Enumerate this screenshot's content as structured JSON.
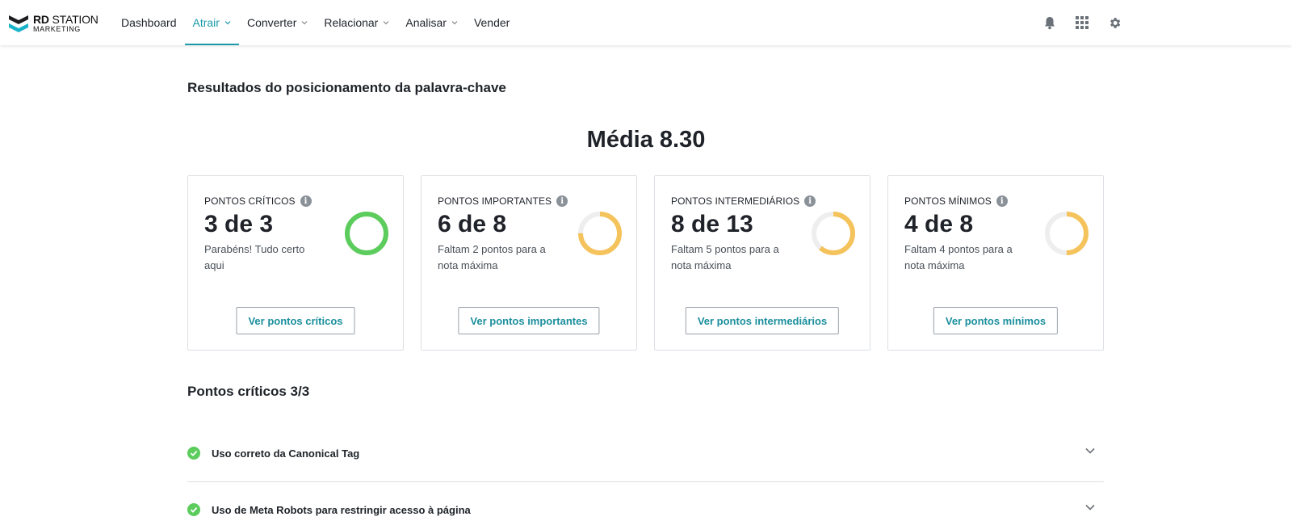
{
  "brand": {
    "line1_bold": "RD",
    "line1_rest": " STATION",
    "line2": "MARKETING"
  },
  "nav": {
    "items": [
      {
        "label": "Dashboard",
        "active": false,
        "dropdown": false
      },
      {
        "label": "Atrair",
        "active": true,
        "dropdown": true
      },
      {
        "label": "Converter",
        "active": false,
        "dropdown": true
      },
      {
        "label": "Relacionar",
        "active": false,
        "dropdown": true
      },
      {
        "label": "Analisar",
        "active": false,
        "dropdown": true
      },
      {
        "label": "Vender",
        "active": false,
        "dropdown": false
      }
    ],
    "icons": [
      "bell-icon",
      "apps-grid-icon",
      "gear-icon"
    ]
  },
  "results_title": "Resultados do posicionamento da palavra-chave",
  "average": "Média 8.30",
  "cards": [
    {
      "label": "PONTOS CRÍTICOS",
      "score": "3 de 3",
      "desc": "Parabéns! Tudo certo aqui",
      "button": "Ver pontos críticos",
      "achieved": 3,
      "total": 3,
      "color": "#5ccc5c"
    },
    {
      "label": "PONTOS IMPORTANTES",
      "score": "6 de 8",
      "desc": "Faltam 2 pontos para a nota máxima",
      "button": "Ver pontos importantes",
      "achieved": 6,
      "total": 8,
      "color": "#f5c35c"
    },
    {
      "label": "PONTOS INTERMEDIÁRIOS",
      "score": "8 de 13",
      "desc": "Faltam 5 pontos para a nota máxima",
      "button": "Ver pontos intermediários",
      "achieved": 8,
      "total": 13,
      "color": "#f5c35c"
    },
    {
      "label": "PONTOS MÍNIMOS",
      "score": "4 de 8",
      "desc": "Faltam 4 pontos para a nota máxima",
      "button": "Ver pontos mínimos",
      "achieved": 4,
      "total": 8,
      "color": "#f5c35c"
    }
  ],
  "critical_section": {
    "title": "Pontos críticos 3/3",
    "items": [
      {
        "label": "Uso correto da Canonical Tag",
        "status": "ok"
      },
      {
        "label": "Uso de Meta Robots para restringir acesso à página",
        "status": "ok"
      }
    ]
  },
  "colors": {
    "accent": "#1b9aaa",
    "success": "#5ccc5c",
    "warning": "#f5c35c",
    "track": "#eeeeee"
  }
}
